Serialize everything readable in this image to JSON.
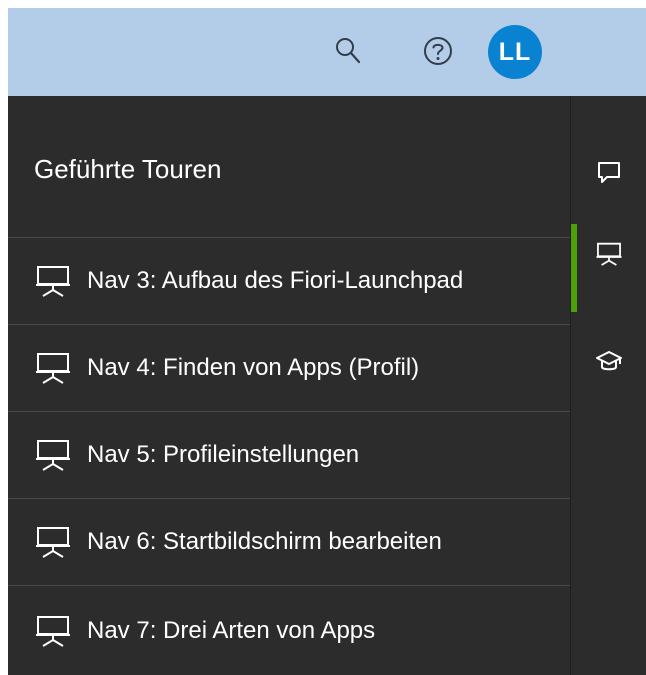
{
  "shell": {
    "icons": {
      "search": "search-icon",
      "help": "help-icon"
    },
    "user_initials": "LL",
    "avatar_color": "#0a82d2",
    "header_color": "#b3cde8"
  },
  "panel": {
    "title": "Geführte Touren",
    "item_icon": "presentation-board-icon",
    "items": [
      {
        "label": "Nav 3: Aufbau des Fiori-Launchpad"
      },
      {
        "label": "Nav 4: Finden von Apps (Profil)"
      },
      {
        "label": "Nav 5: Profileinstellungen"
      },
      {
        "label": "Nav 6: Startbildschirm bearbeiten"
      },
      {
        "label": "Nav 7: Drei Arten von Apps"
      }
    ]
  },
  "rail": {
    "items": [
      {
        "icon": "chat-bubble-icon",
        "active": false
      },
      {
        "icon": "presentation-board-icon",
        "active": true
      },
      {
        "icon": "graduation-cap-icon",
        "active": false
      }
    ],
    "active_indicator_color": "#4ca00a"
  }
}
